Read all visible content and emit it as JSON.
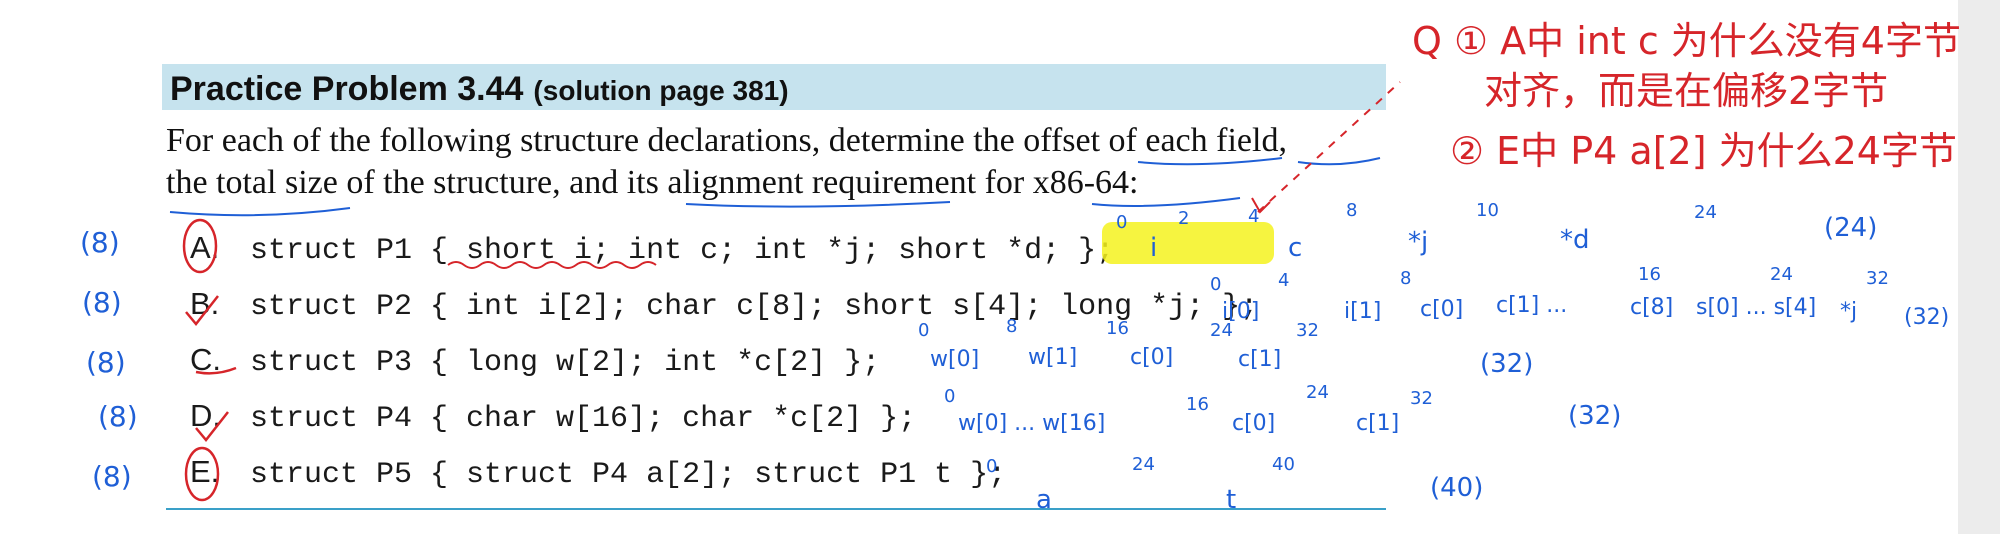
{
  "practice": {
    "title": "Practice Problem 3.44",
    "subtitle": "(solution page 381)",
    "intro_line1": "For each of the following structure declarations, determine the offset of each field,",
    "intro_line2": "the total size of the structure, and its alignment requirement for x86-64:"
  },
  "items": [
    {
      "letter": "A.",
      "code": "struct P1 { short i; int c; int *j; short *d; };"
    },
    {
      "letter": "B.",
      "code": "struct P2 { int i[2]; char c[8]; short s[4]; long *j; };"
    },
    {
      "letter": "C.",
      "code": "struct P3 { long w[2]; int *c[2] };"
    },
    {
      "letter": "D.",
      "code": "struct P4 { char w[16]; char *c[2] };"
    },
    {
      "letter": "E.",
      "code": "struct P5 { struct P4 a[2]; struct P1 t };"
    }
  ],
  "annotations": {
    "colors": {
      "blue": "#1f5fd6",
      "red": "#d6252a",
      "highlight": "#f5f21e"
    },
    "left_alignments": [
      "(8)",
      "(8)",
      "(8)",
      "(8)",
      "(8)"
    ],
    "question_red": [
      "Q ① A中 int c 为什么没有4字节",
      "对齐，而是在偏移2字节",
      "② E中 P4 a[2] 为什么24字节"
    ],
    "row_a": {
      "offsets": [
        "0",
        "2",
        "4",
        "8",
        "10",
        "24"
      ],
      "fields": [
        "i",
        "c",
        "*j",
        "*d"
      ],
      "total": "(24)"
    },
    "row_b": {
      "offsets": [
        "0",
        "4",
        "8",
        "16",
        "24",
        "32"
      ],
      "fields": [
        "i[0]",
        "i[1]",
        "c[0]",
        "c[1] ...",
        "c[8]",
        "s[0] ... s[4]",
        "*j"
      ],
      "total": "(32)"
    },
    "row_c": {
      "offsets": [
        "0",
        "8",
        "16",
        "24",
        "32"
      ],
      "fields": [
        "w[0]",
        "w[1]",
        "c[0]",
        "c[1]"
      ],
      "total": "(32)"
    },
    "row_d": {
      "offsets": [
        "0",
        "16",
        "24",
        "32"
      ],
      "fields": [
        "w[0] ... w[16]",
        "c[0]",
        "c[1]"
      ],
      "total": "(32)"
    },
    "row_e": {
      "offsets": [
        "0",
        "24",
        "40"
      ],
      "fields": [
        "a",
        "t"
      ],
      "total": "(40)"
    }
  }
}
